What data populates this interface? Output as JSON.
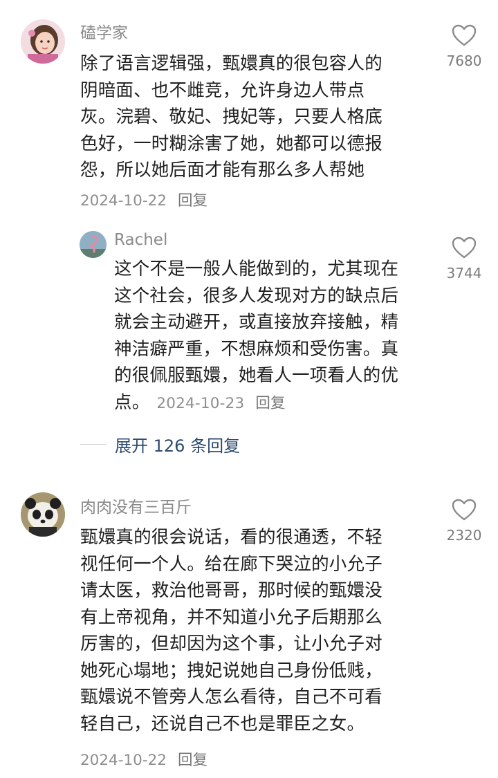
{
  "comments": [
    {
      "author": "磕学家",
      "text": "除了语言逻辑强，甄嬛真的很包容人的\n阴暗面、也不雌竞，允许身边人带点\n灰。浣碧、敬妃、拽妃等，只要人格底\n色好，一时糊涂害了她，她都可以德报\n怨，所以她后面才能有那么多人帮她",
      "date": "2024-10-22",
      "reply_label": "回复",
      "like_count": "7680",
      "avatar_icon": "girl-avatar-icon"
    },
    {
      "author": "Rachel",
      "text": "这个不是一般人能做到的，尤其现在\n这个社会，很多人发现对方的缺点后\n就会主动避开，或直接放弃接触，精\n神洁癖严重，不想麻烦和受伤害。真\n的很佩服甄嬛，她看人一项看人的优\n点。",
      "date": "2024-10-23",
      "reply_label": "回复",
      "like_count": "3744",
      "avatar_icon": "flamingo-avatar-icon"
    },
    {
      "author": "肉肉没有三百斤",
      "text": "甄嬛真的很会说话，看的很通透，不轻\n视任何一个人。给在廊下哭泣的小允子\n请太医，救治他哥哥，那时候的甄嬛没\n有上帝视角，并不知道小允子后期那么\n厉害的，但却因为这个事，让小允子对\n她死心塌地；拽妃说她自己身份低贱，\n甄嬛说不管旁人怎么看待，自己不可看\n轻自己，还说自己不也是罪臣之女。",
      "date": "2024-10-22",
      "reply_label": "回复",
      "like_count": "2320",
      "avatar_icon": "panda-avatar-icon"
    }
  ],
  "expand_replies_label": "展开 126 条回复",
  "colors": {
    "author": "#8a8a8a",
    "text": "#1f1f1f",
    "meta": "#8e8e8e",
    "expand": "#2b4a6f"
  }
}
